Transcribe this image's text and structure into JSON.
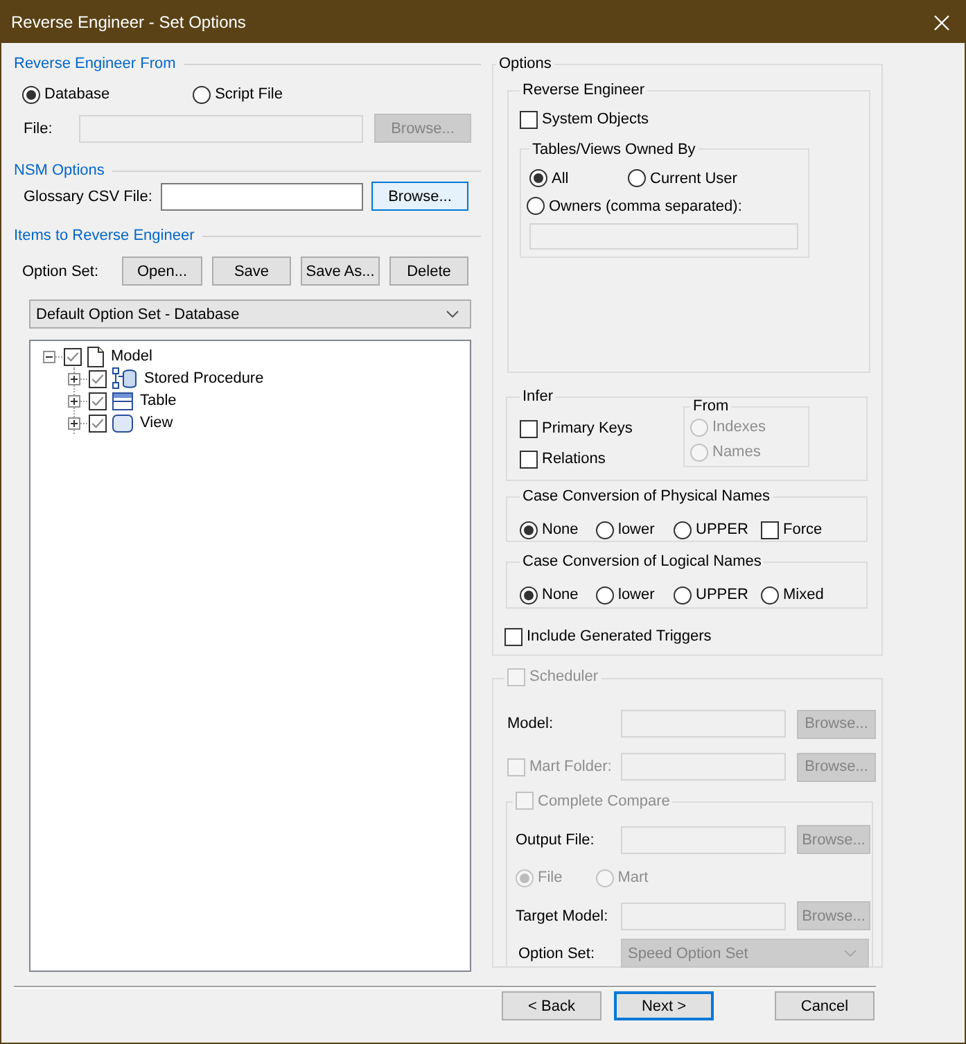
{
  "window": {
    "title": "Reverse Engineer - Set Options"
  },
  "source": {
    "heading": "Reverse Engineer From",
    "options": [
      {
        "label": "Database",
        "selected": true
      },
      {
        "label": "Script File",
        "selected": false
      }
    ],
    "file_label": "File:",
    "file_disabled": true,
    "browse": {
      "label": "Browse...",
      "disabled": true,
      "highlighted": false
    }
  },
  "nsm": {
    "heading": "NSM Options",
    "glossary_label": "Glossary CSV File:",
    "browse": {
      "label": "Browse...",
      "disabled": false,
      "highlighted": true
    }
  },
  "items": {
    "heading": "Items to Reverse Engineer",
    "option_set_label": "Option Set:",
    "buttons": [
      "Open...",
      "Save",
      "Save As...",
      "Delete"
    ],
    "dropdown": "Default Option Set - Database",
    "tree": [
      {
        "label": "Model",
        "kind": "document",
        "checked": true,
        "expanded": true,
        "children": [
          {
            "label": "Stored Procedure",
            "kind": "procedure",
            "checked": true,
            "expanded": false
          },
          {
            "label": "Table",
            "kind": "table",
            "checked": true,
            "expanded": false
          },
          {
            "label": "View",
            "kind": "view",
            "checked": true,
            "expanded": false
          }
        ]
      }
    ]
  },
  "options": {
    "heading": "Options",
    "reverse_engineer": {
      "heading": "Reverse Engineer",
      "system_objects": {
        "label": "System Objects",
        "checked": false
      },
      "owned_by": {
        "heading": "Tables/Views Owned By",
        "options": [
          {
            "label": "All",
            "selected": true
          },
          {
            "label": "Current User",
            "selected": false
          },
          {
            "label": "Owners (comma separated):",
            "selected": false
          }
        ]
      }
    },
    "infer": {
      "heading": "Infer",
      "checks": [
        {
          "label": "Primary Keys",
          "checked": false
        },
        {
          "label": "Relations",
          "checked": false
        }
      ],
      "from": {
        "heading": "From",
        "disabled": true,
        "options": [
          {
            "label": "Indexes",
            "selected": false
          },
          {
            "label": "Names",
            "selected": false
          }
        ]
      }
    },
    "physical": {
      "heading": "Case Conversion of Physical Names",
      "options": [
        {
          "kind": "radio",
          "label": "None",
          "selected": true
        },
        {
          "kind": "radio",
          "label": "lower",
          "selected": false
        },
        {
          "kind": "radio",
          "label": "UPPER",
          "selected": false
        },
        {
          "kind": "checkbox",
          "label": "Force",
          "checked": false
        }
      ]
    },
    "logical": {
      "heading": "Case Conversion of Logical Names",
      "options": [
        {
          "kind": "radio",
          "label": "None",
          "selected": true
        },
        {
          "kind": "radio",
          "label": "lower",
          "selected": false
        },
        {
          "kind": "radio",
          "label": "UPPER",
          "selected": false
        },
        {
          "kind": "radio",
          "label": "Mixed",
          "selected": false
        }
      ]
    },
    "include_triggers": {
      "label": "Include Generated Triggers",
      "checked": false
    }
  },
  "scheduler": {
    "label": "Scheduler",
    "checked": false,
    "disabled": true,
    "model_label": "Model:",
    "model_browse": "Browse...",
    "mart_folder": {
      "label": "Mart Folder:",
      "checked": false
    },
    "mart_browse": "Browse...",
    "complete_compare": {
      "label": "Complete Compare",
      "checked": false,
      "output_file_label": "Output File:",
      "output_browse": "Browse...",
      "targets": [
        {
          "label": "File",
          "selected": true
        },
        {
          "label": "Mart",
          "selected": false
        }
      ],
      "target_model_label": "Target Model:",
      "target_browse": "Browse...",
      "option_set_label": "Option Set:",
      "option_set": "Speed Option Set"
    }
  },
  "footer": {
    "buttons": [
      {
        "label": "< Back",
        "default": false
      },
      {
        "label": "Next >",
        "default": true
      },
      {
        "label": "Cancel",
        "default": false
      }
    ]
  }
}
